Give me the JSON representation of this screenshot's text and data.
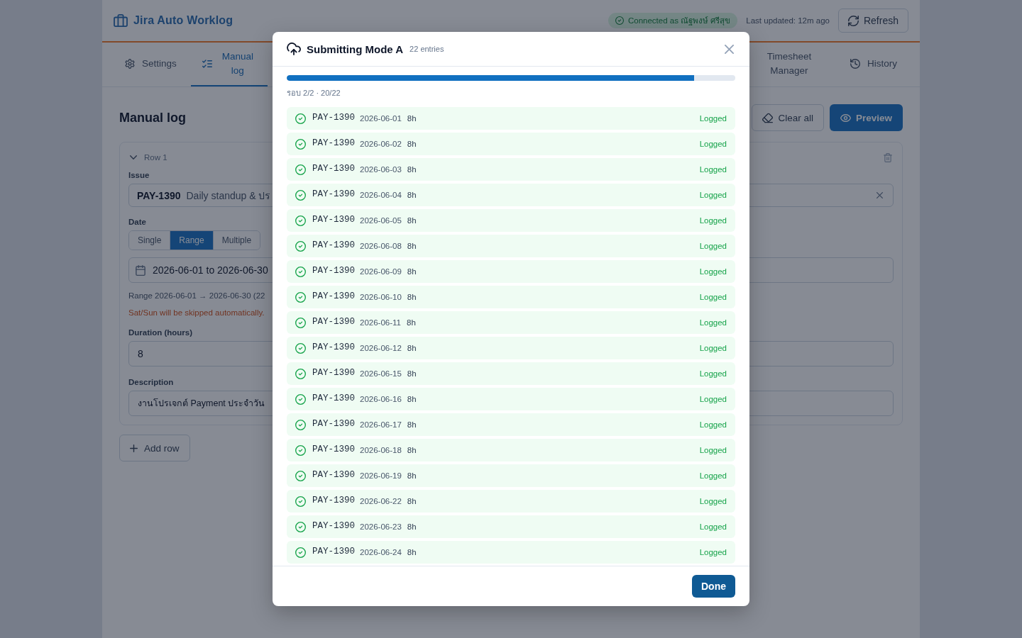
{
  "header": {
    "title": "Jira Auto Worklog",
    "connection": {
      "connected": true,
      "label": "Connected as ณัฐพงษ์ ศรีสุข"
    },
    "last_updated": "Last updated: 12m ago",
    "refresh_button": "Refresh"
  },
  "tabs": [
    {
      "kind": "settings",
      "label": "Settings",
      "selected": false
    },
    {
      "kind": "manual",
      "label": "Manual log",
      "selected": true
    },
    {
      "kind": "timesheet",
      "label": "Timesheet Manager",
      "selected": false
    },
    {
      "kind": "history",
      "label": "History",
      "selected": false
    }
  ],
  "manual_log": {
    "heading": "Manual log",
    "clear_button": "Clear all",
    "preview_button": "Preview",
    "rows": [
      {
        "title": "Row 1",
        "expanded": true,
        "issue_label": "Issue",
        "issue": {
          "key": "PAY-1390",
          "summary": "Daily standup & ปร"
        },
        "date_label": "Date",
        "date_modes": [
          {
            "label": "Single",
            "selected": false
          },
          {
            "label": "Range",
            "selected": true
          },
          {
            "label": "Multiple",
            "selected": false
          }
        ],
        "date_value": "2026-06-01 to 2026-06-30",
        "range_hint": "Range 2026-06-01 → 2026-06-30 (22",
        "weekend_note": "Sat/Sun will be skipped automatically.",
        "duration_label": "Duration (hours)",
        "duration": "8",
        "description_label": "Description",
        "description": "งานโปรเจกต์ Payment ประจำวัน"
      }
    ],
    "add_row_button": "Add row"
  },
  "dialog": {
    "title": "Submitting Mode A",
    "count": "22 entries",
    "progress": {
      "level": 0.909,
      "caption": "รอบ 2/2 · 20/22"
    },
    "entries": [
      {
        "issue": "PAY-1390",
        "date": "2026-06-01",
        "hours": "8h",
        "status": "Logged",
        "success": true
      },
      {
        "issue": "PAY-1390",
        "date": "2026-06-02",
        "hours": "8h",
        "status": "Logged",
        "success": true
      },
      {
        "issue": "PAY-1390",
        "date": "2026-06-03",
        "hours": "8h",
        "status": "Logged",
        "success": true
      },
      {
        "issue": "PAY-1390",
        "date": "2026-06-04",
        "hours": "8h",
        "status": "Logged",
        "success": true
      },
      {
        "issue": "PAY-1390",
        "date": "2026-06-05",
        "hours": "8h",
        "status": "Logged",
        "success": true
      },
      {
        "issue": "PAY-1390",
        "date": "2026-06-08",
        "hours": "8h",
        "status": "Logged",
        "success": true
      },
      {
        "issue": "PAY-1390",
        "date": "2026-06-09",
        "hours": "8h",
        "status": "Logged",
        "success": true
      },
      {
        "issue": "PAY-1390",
        "date": "2026-06-10",
        "hours": "8h",
        "status": "Logged",
        "success": true
      },
      {
        "issue": "PAY-1390",
        "date": "2026-06-11",
        "hours": "8h",
        "status": "Logged",
        "success": true
      },
      {
        "issue": "PAY-1390",
        "date": "2026-06-12",
        "hours": "8h",
        "status": "Logged",
        "success": true
      },
      {
        "issue": "PAY-1390",
        "date": "2026-06-15",
        "hours": "8h",
        "status": "Logged",
        "success": true
      },
      {
        "issue": "PAY-1390",
        "date": "2026-06-16",
        "hours": "8h",
        "status": "Logged",
        "success": true
      },
      {
        "issue": "PAY-1390",
        "date": "2026-06-17",
        "hours": "8h",
        "status": "Logged",
        "success": true
      },
      {
        "issue": "PAY-1390",
        "date": "2026-06-18",
        "hours": "8h",
        "status": "Logged",
        "success": true
      },
      {
        "issue": "PAY-1390",
        "date": "2026-06-19",
        "hours": "8h",
        "status": "Logged",
        "success": true
      },
      {
        "issue": "PAY-1390",
        "date": "2026-06-22",
        "hours": "8h",
        "status": "Logged",
        "success": true
      },
      {
        "issue": "PAY-1390",
        "date": "2026-06-23",
        "hours": "8h",
        "status": "Logged",
        "success": true
      },
      {
        "issue": "PAY-1390",
        "date": "2026-06-24",
        "hours": "8h",
        "status": "Logged",
        "success": true
      }
    ],
    "done_button": "Done"
  }
}
